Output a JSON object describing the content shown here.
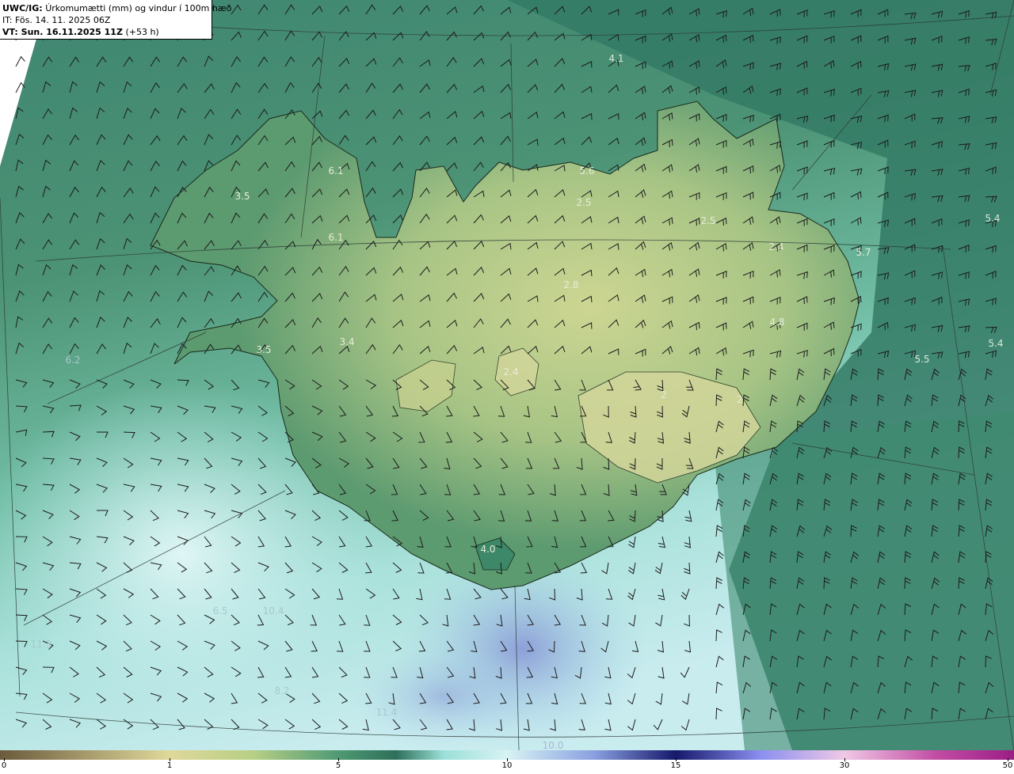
{
  "header": {
    "model": "UWC/IG:",
    "title": "Úrkomumætti (mm) og vindur í 100m hæð",
    "init_time": "IT: Fös. 14. 11. 2025 06Z",
    "valid_prefix": "VT: Sun. 16.11.2025 11Z",
    "valid_suffix": "(+53 h)"
  },
  "map": {
    "region": "Iceland",
    "field": "precipitable water (mm)",
    "overlay": "wind barbs at 100 m",
    "value_labels": [
      "4.1",
      "6.1",
      "5.6",
      "3.5",
      "2.5",
      "2.5",
      "6.1",
      "2.4",
      "5.4",
      "5.7",
      "2.8",
      "4.8",
      "5.4",
      "5.5",
      "3.5",
      "3.4",
      "2.4",
      "2",
      "2",
      "4.0",
      "10.4",
      "6.2",
      "6.5",
      "11.3",
      "11.4",
      "8.2",
      "10.0"
    ]
  },
  "colorbar": {
    "ticks": [
      "0",
      "1",
      "5",
      "10",
      "15",
      "30",
      "50"
    ],
    "colors": {
      "c0": "#6b5a3c",
      "c1": "#e0d89a",
      "c2": "#b7cf85",
      "c3": "#4f9a74",
      "c4": "#2d6f5a",
      "c5": "#9be0d8",
      "c6": "#d8f3f4",
      "c7": "#8aa0e0",
      "c8": "#16186b",
      "c9": "#8b8ff0",
      "c10": "#f0c8e6",
      "c11": "#c24ea4",
      "c12": "#9c1e86"
    }
  }
}
